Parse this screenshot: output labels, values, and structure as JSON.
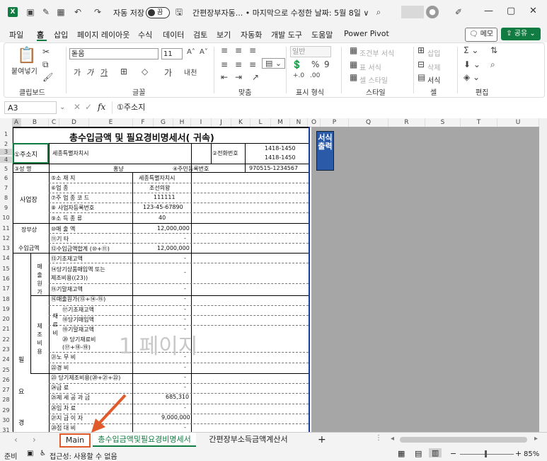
{
  "titlebar": {
    "autosave_label": "자동 저장",
    "toggle_state": "끔",
    "doc_title": "간편장부자동... • 마지막으로 수정한 날짜: 5월 8일 ∨"
  },
  "menu": {
    "items": [
      "파일",
      "홈",
      "삽입",
      "페이지 레이아웃",
      "수식",
      "데이터",
      "검토",
      "보기",
      "자동화",
      "개발 도구",
      "도움말",
      "Power Pivot"
    ],
    "memo": "메모",
    "share": "공유"
  },
  "ribbon": {
    "paste": "붙여넣기",
    "font_name": "돋움",
    "font_size": "11",
    "number_format": "일반",
    "cond_format": "조건부 서식",
    "table_format": "표 서식",
    "cell_style": "셀 스타일",
    "insert": "삽입",
    "delete": "삭제",
    "format": "서식",
    "groups": [
      "클립보드",
      "글꼴",
      "맞춤",
      "표시 형식",
      "스타일",
      "셀",
      "편집"
    ]
  },
  "formula_bar": {
    "name_box": "A3",
    "fx": "fx",
    "content": "①주소지"
  },
  "columns": [
    "A",
    "B",
    "C",
    "D",
    "E",
    "F",
    "G",
    "H",
    "I",
    "J",
    "K",
    "L",
    "M",
    "N",
    "O",
    "P",
    "Q",
    "R",
    "S",
    "T",
    "U"
  ],
  "rows": [
    "1",
    "2",
    "3",
    "4",
    "5",
    "6",
    "7",
    "8",
    "9",
    "10",
    "11",
    "12",
    "13",
    "14",
    "15",
    "16",
    "17",
    "18",
    "19",
    "20",
    "21",
    "22",
    "23",
    "24",
    "25",
    "26",
    "27",
    "28",
    "29",
    "30",
    "31"
  ],
  "sheet": {
    "title": "총수입금액 및 필요경비명세서(  귀속)",
    "address_label": "①주소지",
    "address_value": "세종특별자치시",
    "phone_label": "②전화번호",
    "phone1": "1418-1450",
    "phone2": "1418-1450",
    "name_label": "③성  명",
    "name_value": "홍냥",
    "id_label": "④주민등록번호",
    "id_value": "970515-1234567",
    "biz_label": "사업장",
    "biz_rows": [
      {
        "label": "⑤소  재  지",
        "value": "세종특별자치시"
      },
      {
        "label": "⑥업         종",
        "value": "조선의왕"
      },
      {
        "label": "⑦주 업 종 코 드",
        "value": "111111"
      },
      {
        "label": "⑧ 사업자등록번호",
        "value": "123-45-67890"
      },
      {
        "label": "⑨소 득 종 류",
        "value": "40"
      }
    ],
    "rev_label_1": "장부상",
    "rev_label_2": "수입금액",
    "rev_rows": [
      {
        "label": "⑩매     출     액",
        "value": "12,000,000"
      },
      {
        "label": "⑪기           타",
        "value": "-"
      },
      {
        "label": "⑫수입금액합계 (⑩+⑪)",
        "value": "12,000,000"
      }
    ],
    "cogs_label": "매출원가",
    "cogs_rows": [
      {
        "label": "⑬기초재고액",
        "value": "-"
      },
      {
        "label": "⑭당기상품매입액 또는",
        "value": "-"
      },
      {
        "label": "  제조비용((23))",
        "value": ""
      },
      {
        "label": "⑮기말재고액",
        "value": "-"
      },
      {
        "label": "⑯매출원가(⑬+⑭-⑮)",
        "value": "-"
      }
    ],
    "mfg_label": "제조비용",
    "mat_label": "재료비",
    "mat_rows": [
      {
        "label": "⑰기초재고액",
        "value": "-"
      },
      {
        "label": "⑱당기매입액",
        "value": "-"
      },
      {
        "label": "⑲기말재고액",
        "value": "-"
      },
      {
        "label": "⑳ 당기재료비",
        "value": "-"
      },
      {
        "label": "(⑰+⑱-⑲)",
        "value": ""
      }
    ],
    "mfg_rows": [
      {
        "label": "㉑노   무   비",
        "value": "-"
      },
      {
        "label": "㉒경         비",
        "value": "-"
      },
      {
        "label": "㉓ 당기제조비용(⑳+㉑+㉒)",
        "value": "-"
      }
    ],
    "exp_label": [
      "필",
      "요",
      "경"
    ],
    "exp_rows": [
      {
        "label": "㉔급         료",
        "value": "-"
      },
      {
        "label": "㉕제 세 공 과 금",
        "value": "685,310"
      },
      {
        "label": "㉖임    차    료",
        "value": "-"
      },
      {
        "label": "㉗지  급  이  자",
        "value": "9,000,000"
      },
      {
        "label": "㉘접    대    비",
        "value": "-"
      }
    ],
    "watermark": "1 페이지",
    "print_button": "서식출력"
  },
  "tabs": {
    "main": "Main",
    "active": "총수입금액및필요경비명세서",
    "other": "간편장부소득금액계산서",
    "add": "+"
  },
  "status": {
    "ready": "준비",
    "accessibility": "접근성: 사용할 수 없음",
    "zoom": "85%"
  }
}
